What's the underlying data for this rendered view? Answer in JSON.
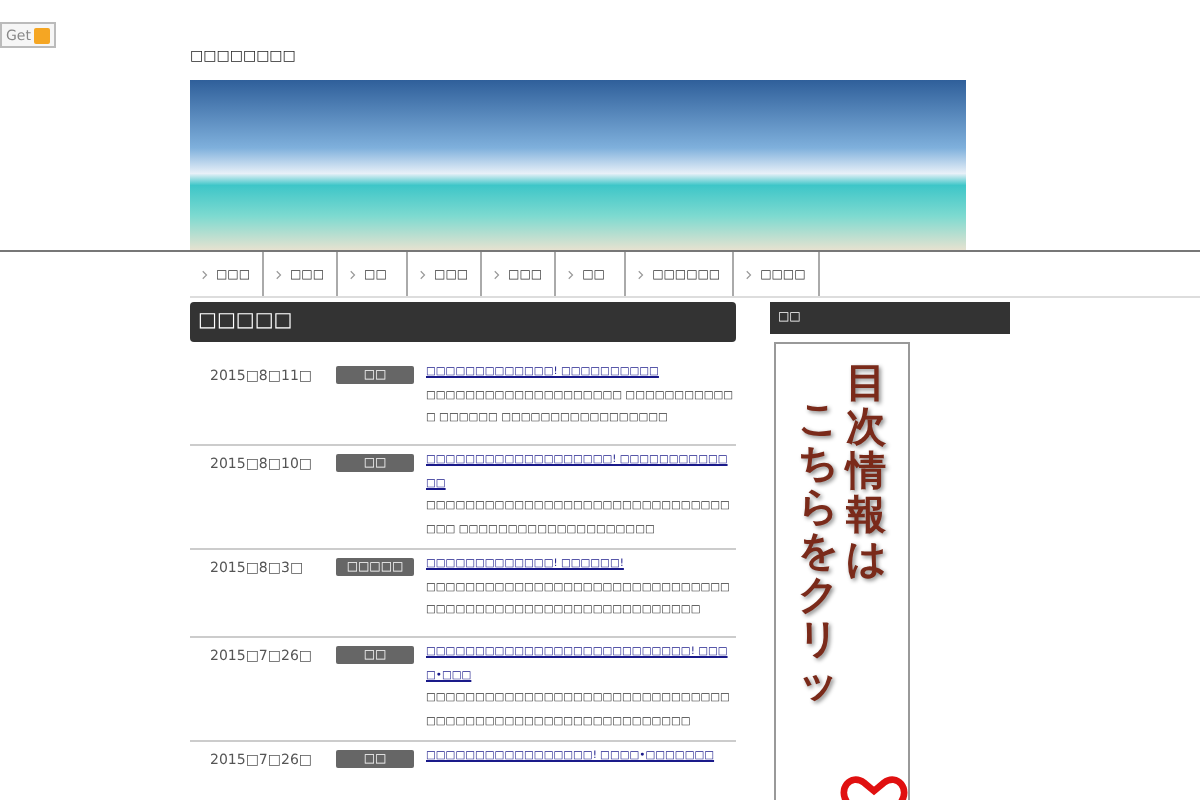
{
  "get_button": {
    "label": "Get"
  },
  "site_title": "□□□□□□□□",
  "nav": [
    {
      "label": "□□□"
    },
    {
      "label": "□□□"
    },
    {
      "label": "□□"
    },
    {
      "label": "□□□"
    },
    {
      "label": "□□□"
    },
    {
      "label": "□□"
    },
    {
      "label": "□□□□□□"
    },
    {
      "label": "□□□□"
    }
  ],
  "main_heading": "□□□□□",
  "posts": [
    {
      "date": "2015□8□11□",
      "category": "□□",
      "title": "□□□□□□□□□□□□□! □□□□□□□□□□",
      "excerpt": "□□□□□□□□□□□□□□□□□□□□ □□□□□□□□□□□□ □□□□□□ □□□□□□□□□□□□□□□□□"
    },
    {
      "date": "2015□8□10□",
      "category": "□□",
      "title": "□□□□□□□□□□□□□□□□□□□! □□□□□□□□□□□□□",
      "excerpt": "□□□□□□□□□□□□□□□□□□□□□□□□□□□□□□□□□□ □□□□□□□□□□□□□□□□□□□□"
    },
    {
      "date": "2015□8□3□",
      "category": "□□□□□",
      "title": "□□□□□□□□□□□□□! □□□□□□!",
      "excerpt": "□□□□□□□□□□□□□□□□□□□□□□□□□□□□□□□□□□□□□□□□□□□□□□□□□□□□□□□□□□□"
    },
    {
      "date": "2015□7□26□",
      "category": "□□",
      "title": "□□□□□□□□□□□□□□□□□□□□□□□□□□□! □□□□•□□□",
      "excerpt": "□□□□□□□□□□□□□□□□□□□□□□□□□□□□□□□□□□□□□□□□□□□□□□□□□□□□□□□□□□"
    },
    {
      "date": "2015□7□26□",
      "category": "□□",
      "title": "□□□□□□□□□□□□□□□□□! □□□□•□□□□□□□"
    }
  ],
  "sidebar": {
    "heading": "□□",
    "banner_lines": [
      "目次情報は",
      "こちらをクリッ"
    ]
  }
}
